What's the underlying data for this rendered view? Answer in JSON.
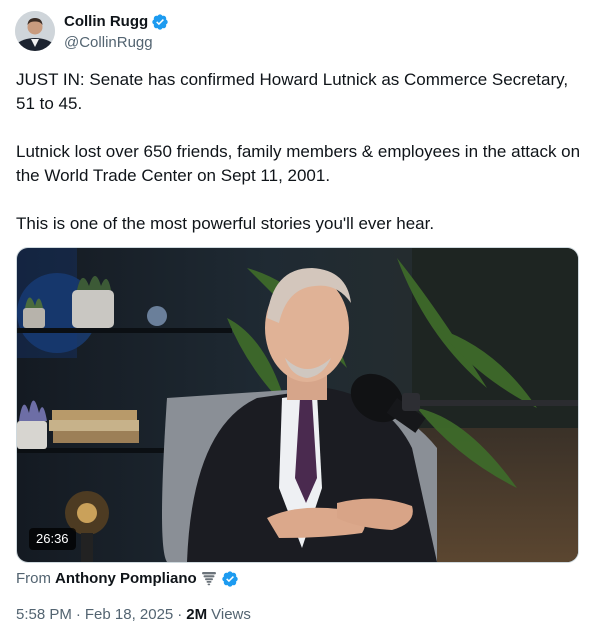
{
  "author": {
    "display_name": "Collin Rugg",
    "handle": "@CollinRugg",
    "verified_icon": "verified-badge-icon",
    "verified_color": "#1d9bf0"
  },
  "tweet": {
    "paragraphs": [
      "JUST IN: Senate has confirmed Howard Lutnick as Commerce Secretary, 51 to 45.",
      "Lutnick lost over 650 friends, family members & employees in the attack on the World Trade Center on Sept 11, 2001.",
      "This is one of the most powerful stories you'll ever hear."
    ]
  },
  "media": {
    "type": "video",
    "duration": "26:36"
  },
  "attribution": {
    "label": "From",
    "name": "Anthony Pompliano",
    "emoji_icon": "tornado-icon",
    "verified_icon": "verified-badge-icon"
  },
  "meta": {
    "time": "5:58 PM",
    "date": "Feb 18, 2025",
    "separator": "·",
    "views_count": "2M",
    "views_label": "Views"
  }
}
